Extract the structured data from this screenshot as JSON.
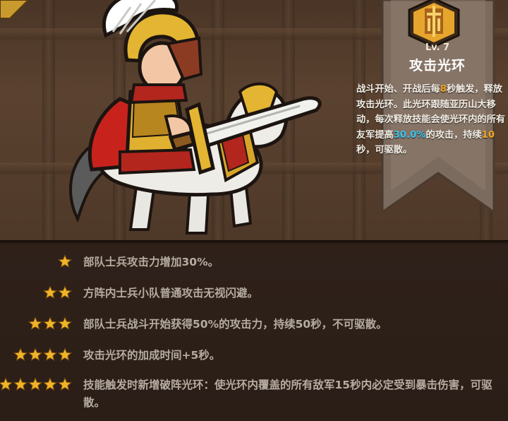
{
  "skill": {
    "level": "Lv. 7",
    "name": "攻击光环",
    "description_parts": [
      {
        "text": "战斗开始、开战后每",
        "style": "normal"
      },
      {
        "text": "8",
        "style": "orange"
      },
      {
        "text": "秒触发，释放攻击光环。此光环跟随亚历山大移动，每次释放技能会使光环内的所有友军提高",
        "style": "normal"
      },
      {
        "text": "30.0%",
        "style": "cyan"
      },
      {
        "text": "的攻击，持续",
        "style": "normal"
      },
      {
        "text": "10",
        "style": "orange"
      },
      {
        "text": "秒，可驱散。",
        "style": "normal"
      }
    ]
  },
  "star_bonuses": [
    {
      "stars": 1,
      "text": "部队士兵攻击力增加30%。"
    },
    {
      "stars": 2,
      "text": "方阵内士兵小队普通攻击无视闪避。"
    },
    {
      "stars": 3,
      "text": "部队士兵战斗开始获得50%的攻击力，持续50秒，不可驱散。"
    },
    {
      "stars": 4,
      "text": "攻击光环的加成时间+5秒。"
    },
    {
      "stars": 5,
      "text": "技能触发时新增破阵光环：使光环内覆盖的所有敌军15秒内必定受到暴击伤害，可驱散。"
    }
  ],
  "icons": {
    "skill_icon": "sword-emblem-icon",
    "star_icon": "star-icon"
  },
  "colors": {
    "highlight_orange": "#f5a623",
    "highlight_cyan": "#37c6f0",
    "star_gold": "#f0b429",
    "bonus_text": "#b6aca0"
  }
}
